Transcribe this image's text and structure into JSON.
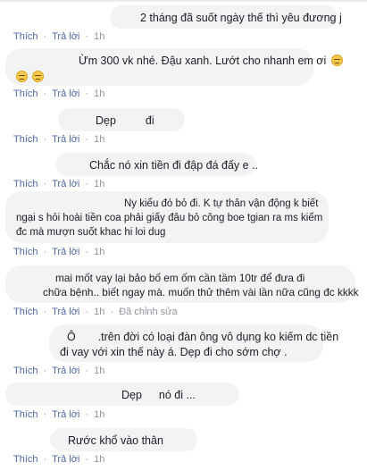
{
  "actions": {
    "like": "Thích",
    "reply": "Trả lời",
    "dot": "·",
    "edited": "Đã chỉnh sửa"
  },
  "comments": [
    {
      "lines": [
        "2 tháng đã suốt ngày thế thì yêu đương j"
      ],
      "time": "1h",
      "edited": false
    },
    {
      "lines": [
        "Ừm 300 vk nhé. Đậu xanh. Lướt cho nhanh em ơi"
      ],
      "emoji": [
        "unamused-face-icon",
        "unamused-face-icon",
        "unamused-face-icon"
      ],
      "time": "1h",
      "edited": false
    },
    {
      "lines": [
        "Dẹp",
        "đi"
      ],
      "time": "1h",
      "edited": false
    },
    {
      "lines": [
        "Chắc nó xin tiền đi đập đá đấy e .."
      ],
      "time": "1h",
      "edited": false
    },
    {
      "lines": [
        "Ny kiểu đó bỏ đi. K tự thân vận động k biết",
        "ngại s hỏi hoài tiền coa phải giấy đâu bỏ công boe tgian ra ms kiếm",
        "đc mà mượn suốt khac hi loi dug"
      ],
      "time": "1h",
      "edited": false
    },
    {
      "lines": [
        "mai mốt vay lại bảo bố em ốm cần tầm 10tr để đưa đi",
        "chữa bệnh.. biết ngay mà. muốn thử thêm vài lần nữa cũng đc kkkk"
      ],
      "time": "1h",
      "edited": true
    },
    {
      "lines": [
        "Ô",
        ".trên đời có loại đàn ông vô dụng ko kiếm dc tiền",
        "đi vay với xin thế này á. Dẹp đi cho sớm chợ ."
      ],
      "time": "1h",
      "edited": false
    },
    {
      "lines": [
        "Dẹp",
        "nó đi ..."
      ],
      "time": "1h",
      "edited": false
    },
    {
      "lines": [
        "Rước khổ vào thân"
      ],
      "time": "1h",
      "edited": false
    }
  ]
}
